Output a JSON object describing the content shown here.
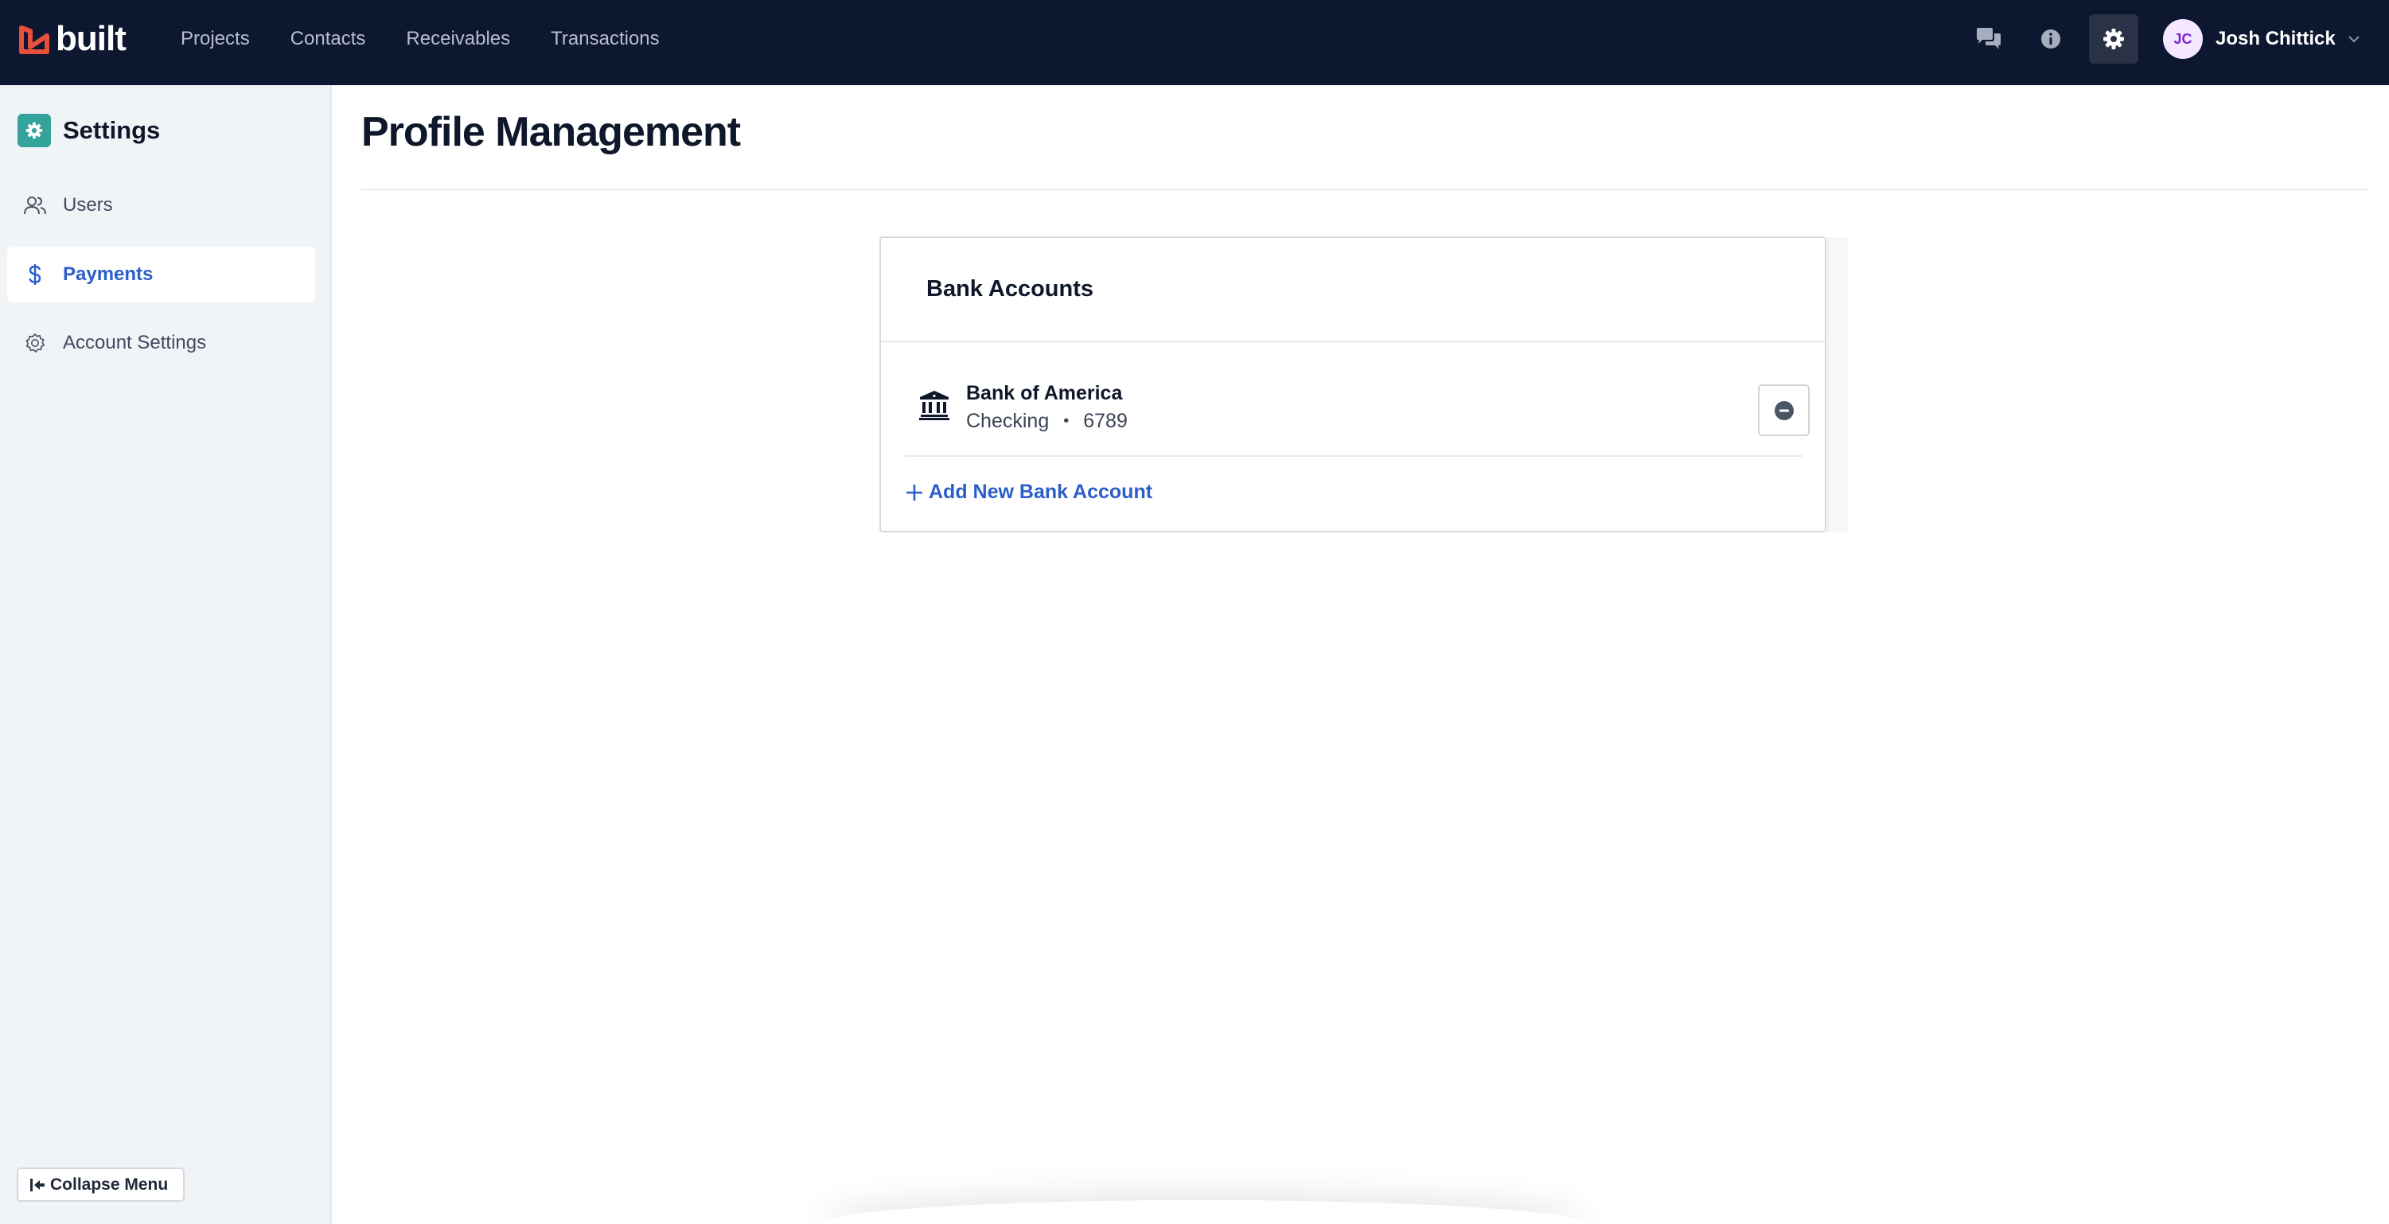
{
  "app": {
    "brand": "built"
  },
  "nav": {
    "items": [
      {
        "label": "Projects"
      },
      {
        "label": "Contacts"
      },
      {
        "label": "Receivables"
      },
      {
        "label": "Transactions"
      }
    ]
  },
  "user": {
    "initials": "JC",
    "name": "Josh Chittick"
  },
  "sidebar": {
    "title": "Settings",
    "items": [
      {
        "label": "Users",
        "icon": "users-icon",
        "active": false
      },
      {
        "label": "Payments",
        "icon": "dollar-icon",
        "active": true
      },
      {
        "label": "Account Settings",
        "icon": "gear-icon",
        "active": false
      }
    ],
    "collapse_label": "Collapse Menu"
  },
  "main": {
    "title": "Profile Management",
    "card": {
      "title": "Bank Accounts",
      "accounts": [
        {
          "bank": "Bank of America",
          "type": "Checking",
          "separator": "•",
          "last4": "6789"
        }
      ],
      "add_label": "Add New Bank Account"
    }
  },
  "colors": {
    "topbar": "#0d1730",
    "accent": "#2a5ec9",
    "logo_red": "#e8503a",
    "settings_teal": "#34a39b",
    "sidebar_bg": "#f1f4f7"
  }
}
